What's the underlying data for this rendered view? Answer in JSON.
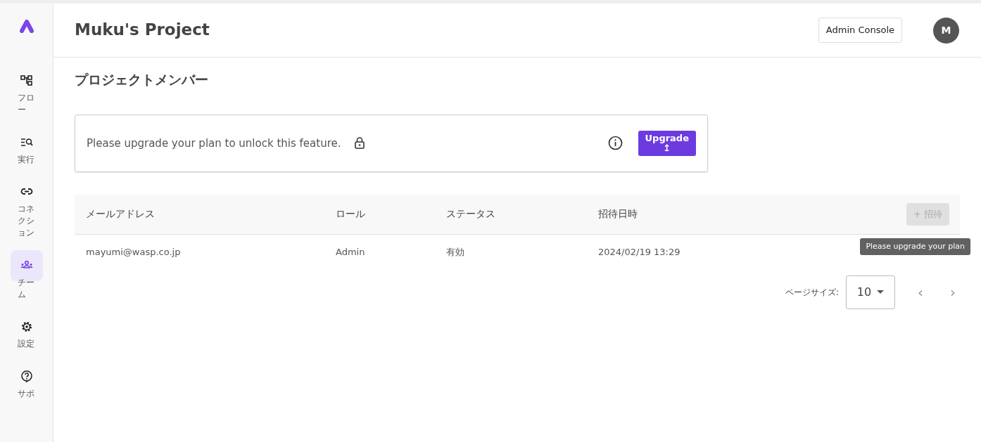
{
  "sidebar": {
    "items": [
      {
        "kind": "flow",
        "label": "フロー",
        "selected": false
      },
      {
        "kind": "run",
        "label": "実行",
        "selected": false
      },
      {
        "kind": "connection",
        "label": "コネクション",
        "selected": false
      },
      {
        "kind": "team",
        "label": "チーム",
        "selected": true
      },
      {
        "kind": "settings",
        "label": "設定",
        "selected": false
      },
      {
        "kind": "support",
        "label": "サポ",
        "selected": false
      }
    ]
  },
  "header": {
    "title": "Muku's Project",
    "admin_button": "Admin Console",
    "avatar": "M"
  },
  "page_title": "プロジェクトメンバー",
  "upgrade_banner": {
    "message": "Please upgrade your plan to unlock this feature.",
    "button": "Upgrade",
    "button_icon": "↥"
  },
  "table": {
    "columns": [
      "メールアドレス",
      "ロール",
      "ステータス",
      "招待日時"
    ],
    "invite_button": {
      "label": "+ 招待",
      "disabled": true
    },
    "tooltip": "Please upgrade your plan",
    "rows": [
      {
        "email": "mayumi@wasp.co.jp",
        "role": "Admin",
        "status": "有効",
        "invited_at": "2024/02/19 13:29"
      }
    ]
  },
  "pagination": {
    "page_size_label": "ページサイズ:",
    "page_size": "10",
    "prev": "‹",
    "next": "›"
  }
}
